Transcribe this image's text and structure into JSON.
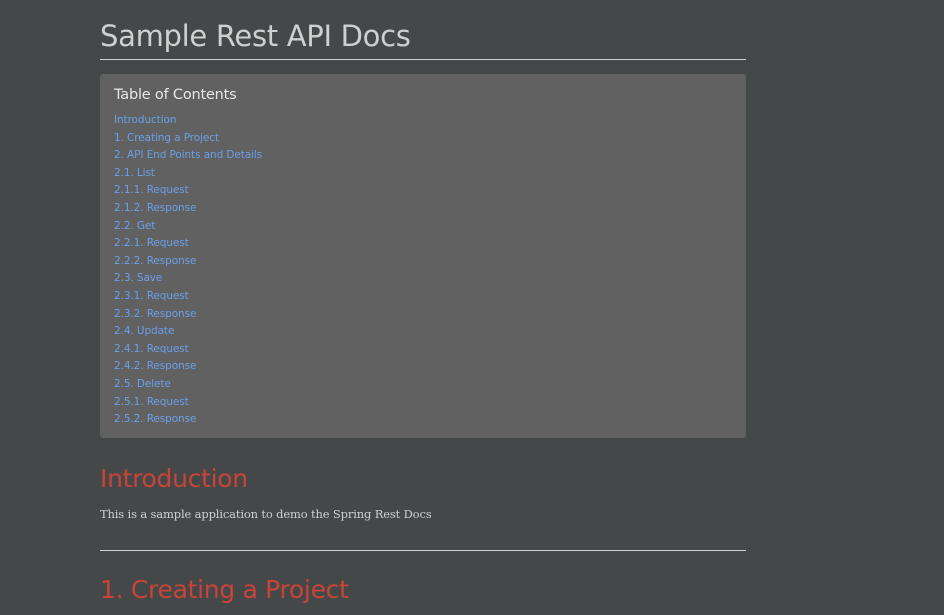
{
  "doc": {
    "title": "Sample Rest API Docs"
  },
  "toc": {
    "title": "Table of Contents",
    "items": [
      {
        "label": "Introduction",
        "level": 1,
        "name": "toc-link-introduction"
      },
      {
        "label": "1. Creating a Project",
        "level": 1,
        "name": "toc-link-creating-project"
      },
      {
        "label": "2. API End Points and Details",
        "level": 1,
        "name": "toc-link-api-endpoints"
      },
      {
        "label": "2.1. List",
        "level": 2,
        "name": "toc-link-list"
      },
      {
        "label": "2.1.1. Request",
        "level": 3,
        "name": "toc-link-list-request"
      },
      {
        "label": "2.1.2. Response",
        "level": 3,
        "name": "toc-link-list-response"
      },
      {
        "label": "2.2. Get",
        "level": 2,
        "name": "toc-link-get"
      },
      {
        "label": "2.2.1. Request",
        "level": 3,
        "name": "toc-link-get-request"
      },
      {
        "label": "2.2.2. Response",
        "level": 3,
        "name": "toc-link-get-response"
      },
      {
        "label": "2.3. Save",
        "level": 2,
        "name": "toc-link-save"
      },
      {
        "label": "2.3.1. Request",
        "level": 3,
        "name": "toc-link-save-request"
      },
      {
        "label": "2.3.2. Response",
        "level": 3,
        "name": "toc-link-save-response"
      },
      {
        "label": "2.4. Update",
        "level": 2,
        "name": "toc-link-update"
      },
      {
        "label": "2.4.1. Request",
        "level": 3,
        "name": "toc-link-update-request"
      },
      {
        "label": "2.4.2. Response",
        "level": 3,
        "name": "toc-link-update-response"
      },
      {
        "label": "2.5. Delete",
        "level": 2,
        "name": "toc-link-delete"
      },
      {
        "label": "2.5.1. Request",
        "level": 3,
        "name": "toc-link-delete-request"
      },
      {
        "label": "2.5.2. Response",
        "level": 3,
        "name": "toc-link-delete-response"
      }
    ]
  },
  "sections": {
    "introduction": {
      "heading": "Introduction",
      "body": "This is a sample application to demo the Spring Rest Docs"
    },
    "creating_project": {
      "heading": "1. Creating a Project"
    }
  },
  "colors": {
    "background": "#454849",
    "toc_background": "#616161",
    "link": "#6b9fe8",
    "section_heading": "#c84439"
  }
}
